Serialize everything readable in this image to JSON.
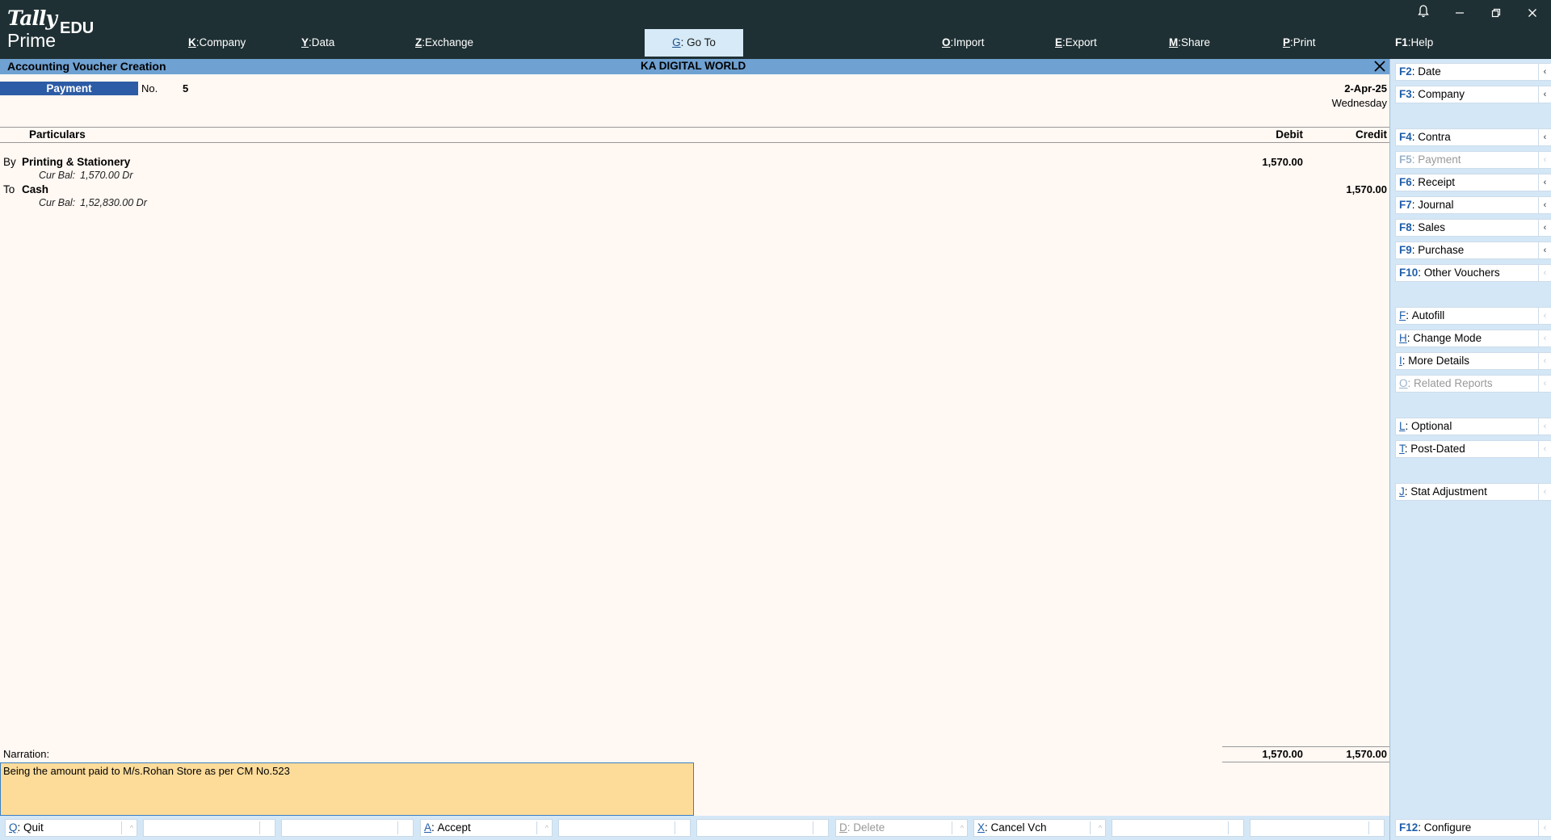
{
  "topbar": {
    "logo_top": "Tally",
    "logo_bottom": "Prime",
    "logo_edition": "EDU",
    "menu": [
      {
        "key": "K",
        "label": "Company"
      },
      {
        "key": "Y",
        "label": "Data"
      },
      {
        "key": "Z",
        "label": "Exchange"
      },
      {
        "key": "G",
        "label": "Go To"
      },
      {
        "key": "O",
        "label": "Import"
      },
      {
        "key": "E",
        "label": "Export"
      },
      {
        "key": "M",
        "label": "Share"
      },
      {
        "key": "P",
        "label": "Print"
      },
      {
        "key": "F1",
        "label": "Help"
      }
    ],
    "window_controls": [
      "bell-icon",
      "minimize-icon",
      "restore-icon",
      "close-icon"
    ]
  },
  "titlebar": {
    "title": "Accounting Voucher Creation",
    "company": "KA DIGITAL WORLD"
  },
  "voucher": {
    "type": "Payment",
    "no_label": "No.",
    "no_value": "5",
    "date": "2-Apr-25",
    "day": "Wednesday",
    "columns": {
      "particulars": "Particulars",
      "debit": "Debit",
      "credit": "Credit"
    },
    "entries": [
      {
        "prefix": "By",
        "ledger": "Printing & Stationery",
        "curbal_label": "Cur Bal:",
        "curbal": "1,570.00 Dr",
        "debit": "1,570.00",
        "credit": ""
      },
      {
        "prefix": "To",
        "ledger": "Cash",
        "curbal_label": "Cur Bal:",
        "curbal": "1,52,830.00 Dr",
        "debit": "",
        "credit": "1,570.00"
      }
    ],
    "narration_label": "Narration:",
    "narration": "Being the amount paid to M/s.Rohan Store as per CM No.523",
    "total_debit": "1,570.00",
    "total_credit": "1,570.00"
  },
  "bottombar": [
    {
      "key": "Q",
      "label": "Quit",
      "enabled": true
    },
    {
      "key": "",
      "label": "",
      "enabled": true
    },
    {
      "key": "",
      "label": "",
      "enabled": true
    },
    {
      "key": "A",
      "label": "Accept",
      "enabled": true
    },
    {
      "key": "",
      "label": "",
      "enabled": true
    },
    {
      "key": "",
      "label": "",
      "enabled": true
    },
    {
      "key": "D",
      "label": "Delete",
      "enabled": false
    },
    {
      "key": "X",
      "label": "Cancel Vch",
      "enabled": true
    },
    {
      "key": "",
      "label": "",
      "enabled": true
    },
    {
      "key": "",
      "label": "",
      "enabled": true
    }
  ],
  "sidebar": [
    {
      "key": "F2",
      "label": "Date",
      "enabled": true
    },
    {
      "key": "F3",
      "label": "Company",
      "enabled": true
    },
    {
      "key": "F4",
      "label": "Contra",
      "enabled": true
    },
    {
      "key": "F5",
      "label": "Payment",
      "enabled": false
    },
    {
      "key": "F6",
      "label": "Receipt",
      "enabled": true
    },
    {
      "key": "F7",
      "label": "Journal",
      "enabled": true
    },
    {
      "key": "F8",
      "label": "Sales",
      "enabled": true
    },
    {
      "key": "F9",
      "label": "Purchase",
      "enabled": true
    },
    {
      "key": "F10",
      "label": "Other Vouchers",
      "enabled": true
    },
    {
      "key": "F",
      "label": "Autofill",
      "enabled": true
    },
    {
      "key": "H",
      "label": "Change Mode",
      "enabled": true
    },
    {
      "key": "I",
      "label": "More Details",
      "enabled": true
    },
    {
      "key": "O",
      "label": "Related Reports",
      "enabled": false
    },
    {
      "key": "L",
      "label": "Optional",
      "enabled": true
    },
    {
      "key": "T",
      "label": "Post-Dated",
      "enabled": true
    },
    {
      "key": "J",
      "label": "Stat Adjustment",
      "enabled": true
    },
    {
      "key": "F12",
      "label": "Configure",
      "enabled": true
    }
  ],
  "colors": {
    "topbar_bg": "#1f3034",
    "titlebar_bg": "#6fa1d2",
    "voucher_type_bg": "#2c5ca5",
    "main_bg": "#fff8f3",
    "narration_bg": "#fddc9a",
    "panel_bg": "#d4e7f6"
  }
}
